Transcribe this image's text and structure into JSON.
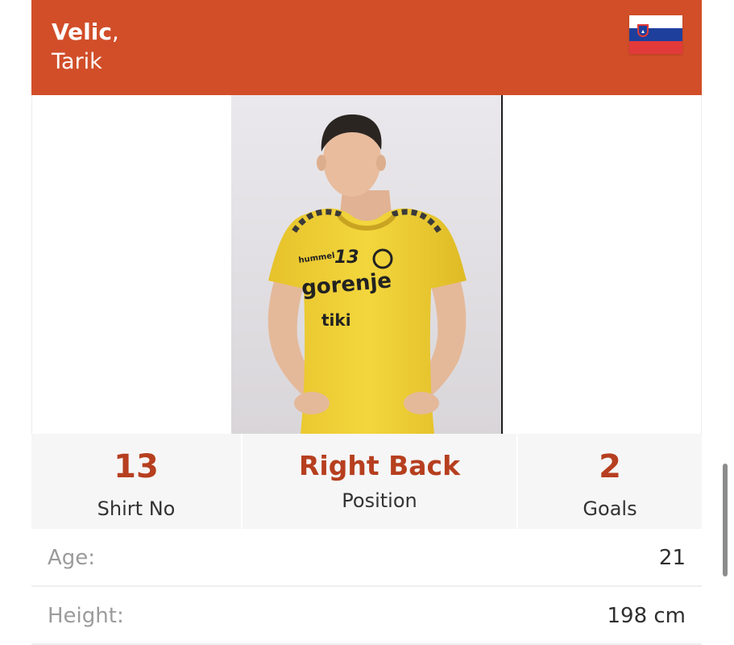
{
  "player": {
    "last_name": "Velic",
    "comma": ",",
    "first_name": "Tarik",
    "flag_icon": "slovenia-flag-icon",
    "photo": {
      "jersey_number": "13",
      "sponsor_main": "gorenje",
      "sponsor_secondary": "tiki",
      "brand": "hummel"
    }
  },
  "stats": [
    {
      "value": "13",
      "label": "Shirt No"
    },
    {
      "value": "Right Back",
      "label": "Position"
    },
    {
      "value": "2",
      "label": "Goals"
    }
  ],
  "details": [
    {
      "label": "Age:",
      "value": "21"
    },
    {
      "label": "Height:",
      "value": "198 cm"
    }
  ],
  "colors": {
    "header_bg": "#d14e29",
    "stat_value": "#b63f1f",
    "jersey": "#f1d33a"
  }
}
